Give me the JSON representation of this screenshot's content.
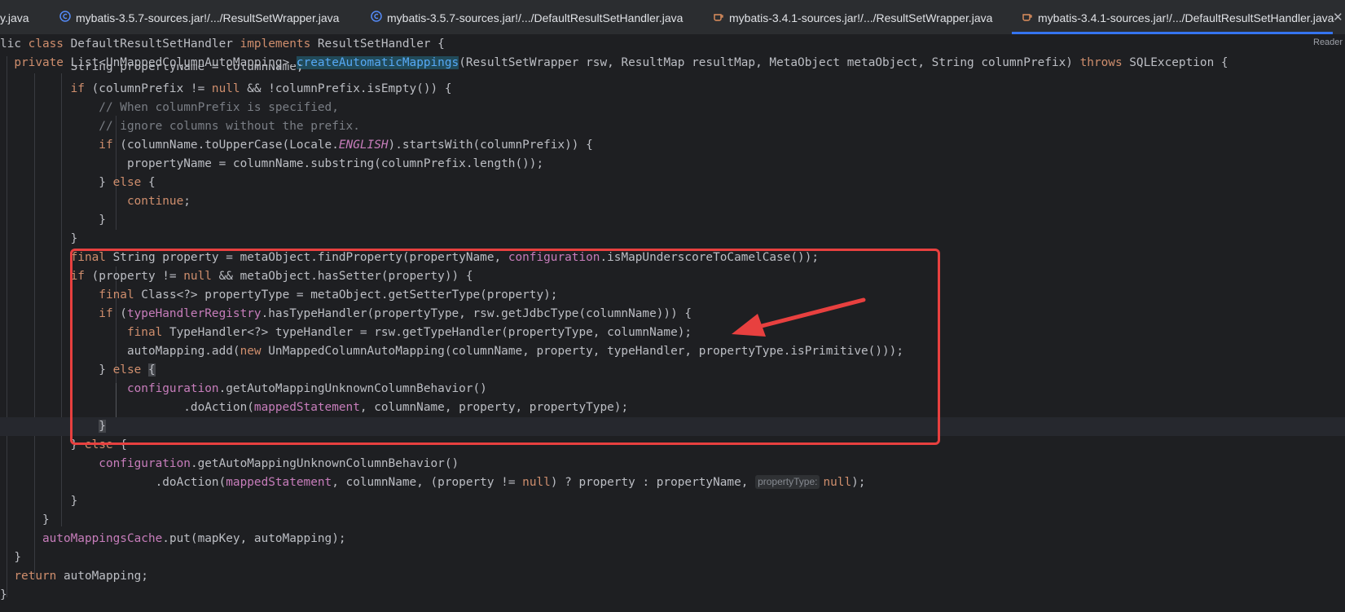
{
  "tabs": [
    {
      "label": "y.java",
      "icon": "none",
      "active": false
    },
    {
      "label": "mybatis-3.5.7-sources.jar!/.../ResultSetWrapper.java",
      "icon": "class-icon",
      "active": false
    },
    {
      "label": "mybatis-3.5.7-sources.jar!/.../DefaultResultSetHandler.java",
      "icon": "class-icon",
      "active": false
    },
    {
      "label": "mybatis-3.4.1-sources.jar!/.../ResultSetWrapper.java",
      "icon": "java-cup-icon",
      "active": false
    },
    {
      "label": "mybatis-3.4.1-sources.jar!/.../DefaultResultSetHandler.java",
      "icon": "java-cup-icon",
      "active": true
    }
  ],
  "tab_close_glyph": "✕",
  "reader_mode_label": "Reader",
  "sticky": {
    "l1": {
      "a": "lic ",
      "b": "class",
      "c": " DefaultResultSetHandler ",
      "d": "implements",
      "e": " ResultSetHandler {"
    },
    "l2": {
      "a": "  ",
      "b": "private",
      "c": " List<UnMappedColumnAutoMapping> ",
      "d": "createAutomaticMappings",
      "e": "(ResultSetWrapper rsw, ResultMap resultMap, MetaObject metaObject, String columnPrefix) ",
      "f": "throws",
      "g": " SQLException {"
    }
  },
  "code": {
    "l3": {
      "a": "          String propertyName = columnName;"
    },
    "l4": {
      "a": "          ",
      "b": "if",
      "c": " (columnPrefix != ",
      "d": "null",
      "e": " && !columnPrefix.isEmpty()) {"
    },
    "l5": {
      "a": "              ",
      "b": "// When columnPrefix is specified,"
    },
    "l6": {
      "a": "              ",
      "b": "// ignore columns without the prefix."
    },
    "l7": {
      "a": "              ",
      "b": "if",
      "c": " (columnName.toUpperCase(Locale.",
      "d": "ENGLISH",
      "e": ").startsWith(columnPrefix)) {"
    },
    "l8": {
      "a": "                  propertyName = columnName.substring(columnPrefix.length());"
    },
    "l9": {
      "a": "              } ",
      "b": "else",
      "c": " {"
    },
    "l10": {
      "a": "                  ",
      "b": "continue",
      "c": ";"
    },
    "l11": {
      "a": "              }"
    },
    "l12": {
      "a": "          }"
    },
    "l13": {
      "a": "          ",
      "b": "final",
      "c": " String property = metaObject.findProperty(propertyName, ",
      "d": "configuration",
      "e": ".isMapUnderscoreToCamelCase());"
    },
    "l14": {
      "a": "          ",
      "b": "if",
      "c": " (property != ",
      "d": "null",
      "e": " && metaObject.hasSetter(property)) {"
    },
    "l15": {
      "a": "              ",
      "b": "final",
      "c": " Class<?> propertyType = metaObject.getSetterType(property);"
    },
    "l16": {
      "a": "              ",
      "b": "if",
      "c": " (",
      "d": "typeHandlerRegistry",
      "e": ".hasTypeHandler(propertyType, rsw.getJdbcType(columnName))) {"
    },
    "l17": {
      "a": "                  ",
      "b": "final",
      "c": " TypeHandler<?> typeHandler = rsw.getTypeHandler(propertyType, columnName);"
    },
    "l18": {
      "a": "                  autoMapping.add(",
      "b": "new",
      "c": " UnMappedColumnAutoMapping(columnName, property, typeHandler, propertyType.isPrimitive()));"
    },
    "l19": {
      "a": "              } ",
      "b": "else",
      "c": " ",
      "d": "{"
    },
    "l20": {
      "a": "                  ",
      "b": "configuration",
      "c": ".getAutoMappingUnknownColumnBehavior()"
    },
    "l21": {
      "a": "                          .doAction(",
      "b": "mappedStatement",
      "c": ", columnName, property, propertyType);"
    },
    "l22": {
      "a": "              ",
      "b": "}"
    },
    "l23": {
      "a": "          } ",
      "b": "else",
      "c": " {"
    },
    "l24": {
      "a": "              ",
      "b": "configuration",
      "c": ".getAutoMappingUnknownColumnBehavior()"
    },
    "l25": {
      "a": "                      .doAction(",
      "b": "mappedStatement",
      "c": ", columnName, (property != ",
      "d": "null",
      "e": ") ? property : propertyName, ",
      "f": "propertyType:",
      "g": "null",
      "h": ");"
    },
    "l26": {
      "a": "          }"
    },
    "l27": {
      "a": "      }"
    },
    "l28": {
      "a": "      ",
      "b": "autoMappingsCache",
      "c": ".put(mapKey, autoMapping);"
    },
    "l29": {
      "a": "  }"
    },
    "l30": {
      "a": "  ",
      "b": "return",
      "c": " autoMapping;"
    },
    "l31": {
      "a": "}"
    }
  },
  "colors": {
    "background": "#1e1f22",
    "keyword": "#cf8e6d",
    "method": "#56a8f5",
    "field": "#c77dbb",
    "comment": "#7a7e85",
    "text": "#bcbec4",
    "annotation_box": "#e8403f",
    "active_tab_underline": "#3574f0"
  }
}
